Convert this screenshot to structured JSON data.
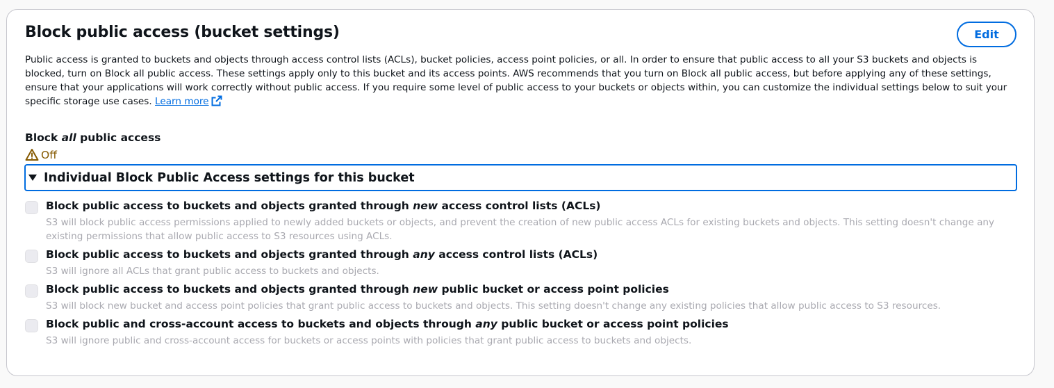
{
  "header": {
    "title": "Block public access (bucket settings)",
    "edit_label": "Edit"
  },
  "description": {
    "text": "Public access is granted to buckets and objects through access control lists (ACLs), bucket policies, access point policies, or all. In order to ensure that public access to all your S3 buckets and objects is blocked, turn on Block all public access. These settings apply only to this bucket and its access points. AWS recommends that you turn on Block all public access, but before applying any of these settings, ensure that your applications will work correctly without public access. If you require some level of public access to your buckets or objects within, you can customize the individual settings below to suit your specific storage use cases.",
    "learn_more": "Learn more",
    "learn_more_icon": "external-link-icon"
  },
  "block_all": {
    "label_prefix": "Block ",
    "label_emphasis": "all",
    "label_suffix": " public access",
    "status_icon": "warning-icon",
    "status": "Off",
    "status_color": "#855900"
  },
  "expander": {
    "label": "Individual Block Public Access settings for this bucket",
    "expanded": true
  },
  "options": [
    {
      "label_prefix": "Block public access to buckets and objects granted through ",
      "label_emphasis": "new",
      "label_suffix": " access control lists (ACLs)",
      "description": "S3 will block public access permissions applied to newly added buckets or objects, and prevent the creation of new public access ACLs for existing buckets and objects. This setting doesn't change any existing permissions that allow public access to S3 resources using ACLs.",
      "checked": false,
      "disabled": true
    },
    {
      "label_prefix": "Block public access to buckets and objects granted through ",
      "label_emphasis": "any",
      "label_suffix": " access control lists (ACLs)",
      "description": "S3 will ignore all ACLs that grant public access to buckets and objects.",
      "checked": false,
      "disabled": true
    },
    {
      "label_prefix": "Block public access to buckets and objects granted through ",
      "label_emphasis": "new",
      "label_suffix": " public bucket or access point policies",
      "description": "S3 will block new bucket and access point policies that grant public access to buckets and objects. This setting doesn't change any existing policies that allow public access to S3 resources.",
      "checked": false,
      "disabled": true
    },
    {
      "label_prefix": "Block public and cross-account access to buckets and objects through ",
      "label_emphasis": "any",
      "label_suffix": " public bucket or access point policies",
      "description": "S3 will ignore public and cross-account access for buckets or access points with policies that grant public access to buckets and objects.",
      "checked": false,
      "disabled": true
    }
  ],
  "colors": {
    "accent": "#006ce0",
    "text": "#0f141a",
    "muted": "#a9a9b0",
    "warning": "#855900"
  }
}
